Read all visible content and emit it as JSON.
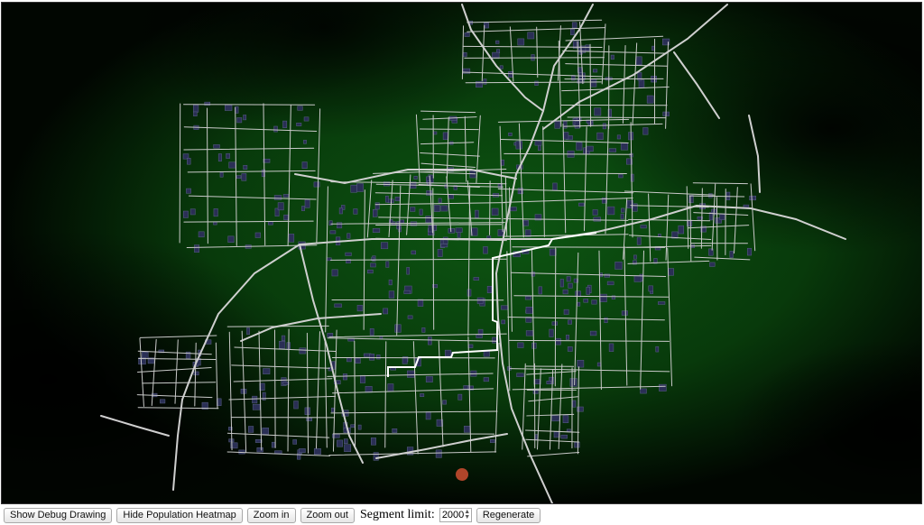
{
  "toolbar": {
    "debug_label": "Show Debug Drawing",
    "heatmap_label": "Hide Population Heatmap",
    "zoom_in_label": "Zoom in",
    "zoom_out_label": "Zoom out",
    "segment_limit_label": "Segment limit:",
    "segment_limit_value": "2000",
    "regenerate_label": "Regenerate"
  },
  "map": {
    "road_color": "#c9c9c9",
    "highlight_color": "#ffffff",
    "building_color": "#2a2f55",
    "marker_color": "#b0452a",
    "heat_colors": [
      "#000000",
      "#0b4a10"
    ]
  }
}
